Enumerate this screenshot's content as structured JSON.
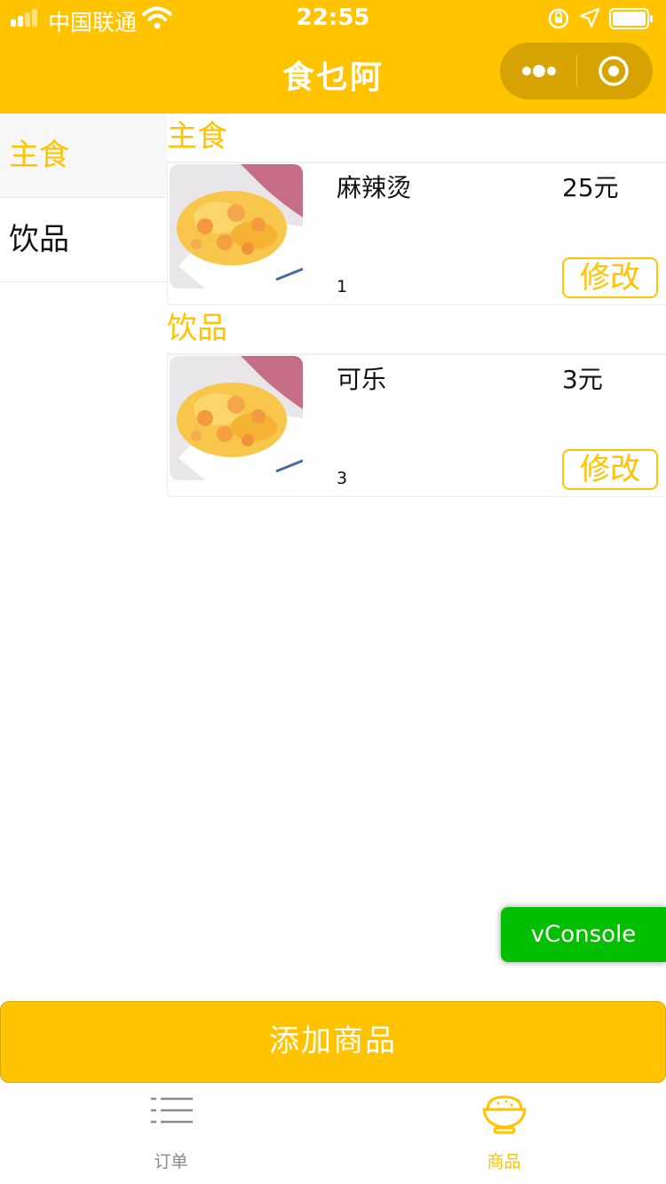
{
  "status_bar": {
    "carrier": "中国联通",
    "time": "22:55"
  },
  "nav": {
    "title": "食乜阿"
  },
  "sidebar": {
    "items": [
      {
        "label": "主食",
        "active": true
      },
      {
        "label": "饮品",
        "active": false
      }
    ]
  },
  "categories": [
    {
      "title": "主食",
      "products": [
        {
          "name": "麻辣烫",
          "price": "25元",
          "qty": "1",
          "edit_label": "修改"
        }
      ]
    },
    {
      "title": "饮品",
      "products": [
        {
          "name": "可乐",
          "price": "3元",
          "qty": "3",
          "edit_label": "修改"
        }
      ]
    }
  ],
  "vconsole": {
    "label": "vConsole"
  },
  "add_button": {
    "label": "添加商品"
  },
  "tabbar": {
    "tabs": [
      {
        "label": "订单",
        "icon": "list-icon",
        "active": false
      },
      {
        "label": "商品",
        "icon": "rice-bowl-icon",
        "active": true
      }
    ]
  },
  "colors": {
    "accent": "#FFC300",
    "vconsole": "#04BE02",
    "inactive_tab": "#8a8a8a"
  }
}
